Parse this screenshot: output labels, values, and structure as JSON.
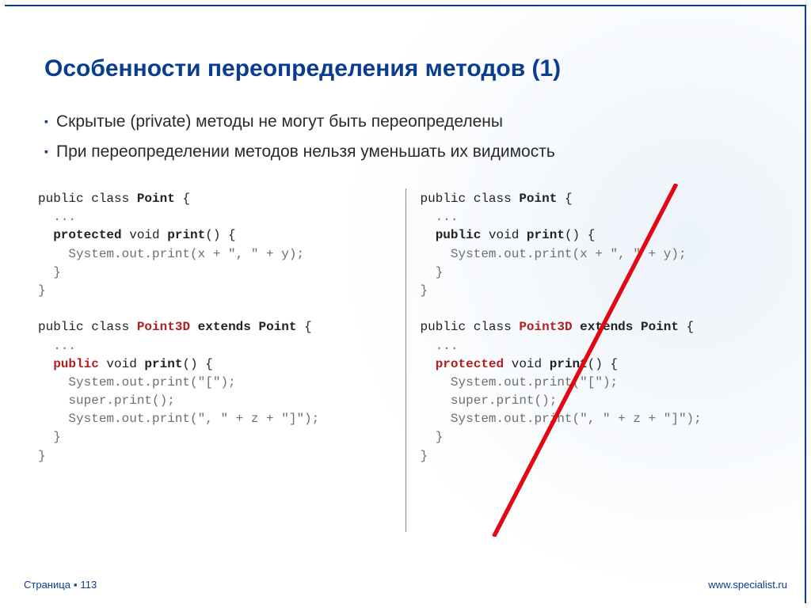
{
  "title": "Особенности переопределения методов (1)",
  "bullets": [
    "Скрытые (private) методы не могут быть переопределены",
    "При переопределении методов нельзя уменьшать их видимость"
  ],
  "code_left": {
    "l1a": "public class ",
    "l1b": "Point",
    "l1c": " {",
    "l2": "  ...",
    "l3a": "  ",
    "l3b": "protected",
    "l3c": " void ",
    "l3d": "print",
    "l3e": "() {",
    "l4": "    System.out.print(x + \", \" + y);",
    "l5": "  }",
    "l6": "}",
    "l7": "",
    "l8a": "public class ",
    "l8b": "Point3D",
    "l8c": " ",
    "l8d": "extends",
    "l8e": " ",
    "l8f": "Point",
    "l8g": " {",
    "l9": "  ...",
    "l10a": "  ",
    "l10b": "public",
    "l10c": " void ",
    "l10d": "print",
    "l10e": "() {",
    "l11": "    System.out.print(\"[\");",
    "l12": "    super.print();",
    "l13": "    System.out.print(\", \" + z + \"]\");",
    "l14": "  }",
    "l15": "}"
  },
  "code_right": {
    "l1a": "public class ",
    "l1b": "Point",
    "l1c": " {",
    "l2": "  ...",
    "l3a": "  ",
    "l3b": "public",
    "l3c": " void ",
    "l3d": "print",
    "l3e": "() {",
    "l4": "    System.out.print(x + \", \" + y);",
    "l5": "  }",
    "l6": "}",
    "l7": "",
    "l8a": "public class ",
    "l8b": "Point3D",
    "l8c": " ",
    "l8d": "extends",
    "l8e": " ",
    "l8f": "Point",
    "l8g": " {",
    "l9": "  ...",
    "l10a": "  ",
    "l10b": "protected",
    "l10c": " void ",
    "l10d": "print",
    "l10e": "() {",
    "l11": "    System.out.print(\"[\");",
    "l12": "    super.print();",
    "l13": "    System.out.print(\", \" + z + \"]\");",
    "l14": "  }",
    "l15": "}"
  },
  "footer": {
    "page_label": "Страница",
    "page_number": "113",
    "url": "www.specialist.ru"
  }
}
